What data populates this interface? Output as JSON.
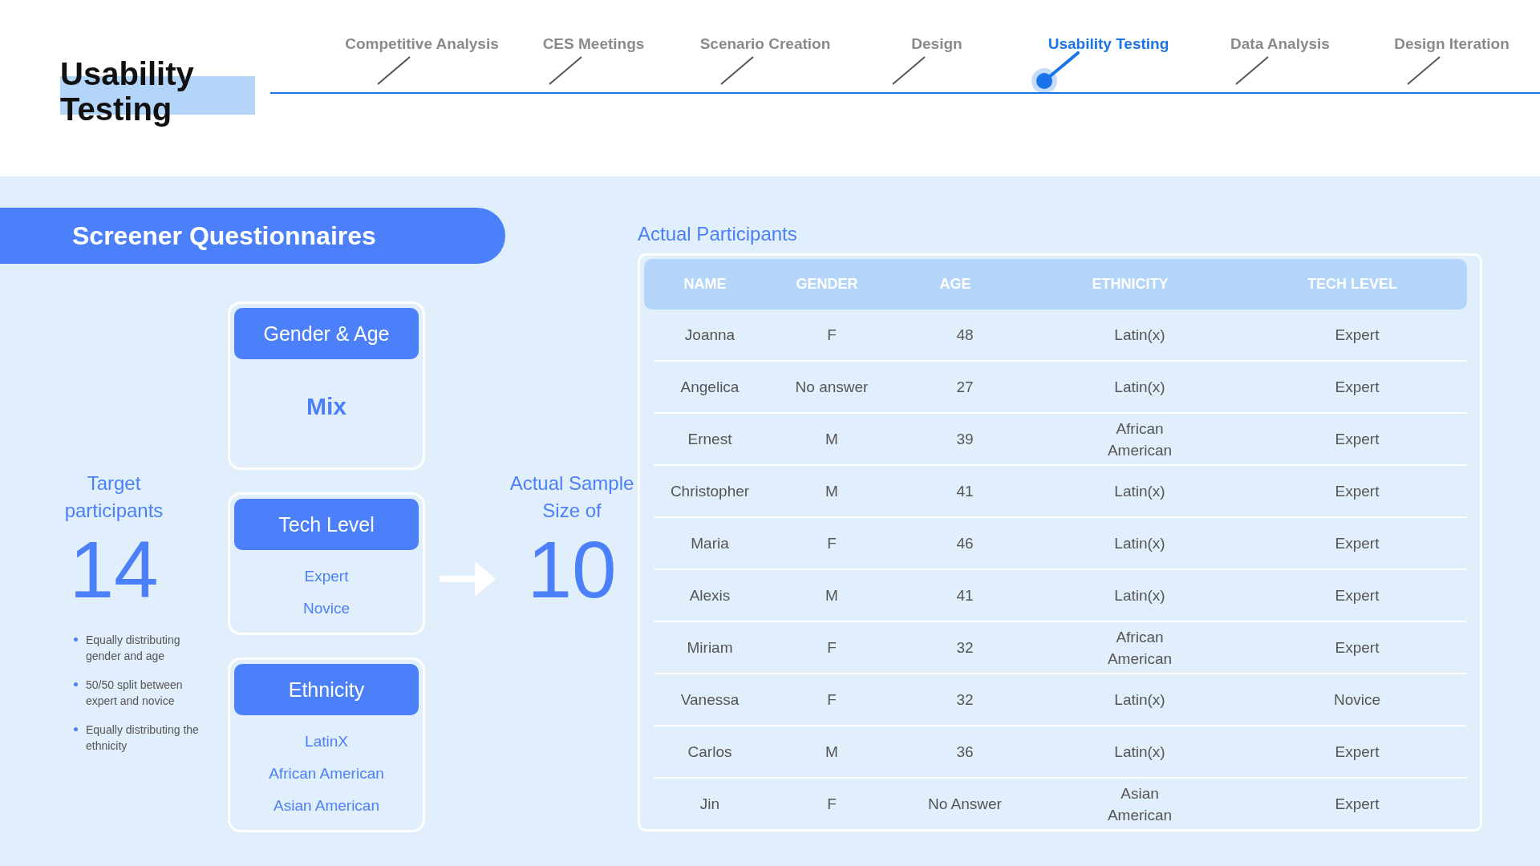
{
  "title": "Usability Testing",
  "timeline": {
    "steps": [
      {
        "label": "Competitive Analysis",
        "selected": false
      },
      {
        "label": "CES Meetings",
        "selected": false
      },
      {
        "label": "Scenario Creation",
        "selected": false
      },
      {
        "label": "Design",
        "selected": false
      },
      {
        "label": "Usability Testing",
        "selected": true
      },
      {
        "label": "Data Analysis",
        "selected": false
      },
      {
        "label": "Design Iteration",
        "selected": false
      }
    ]
  },
  "banner": "Screener Questionnaires",
  "target": {
    "label": "Target participants",
    "number": "14",
    "bullets": [
      "Equally distributing gender and age",
      "50/50 split between expert and novice",
      "Equally distributing the ethnicity"
    ]
  },
  "cards": [
    {
      "title": "Gender & Age",
      "kind": "emphasis",
      "items": [
        "Mix"
      ]
    },
    {
      "title": "Tech Level",
      "kind": "list",
      "items": [
        "Expert",
        "Novice"
      ]
    },
    {
      "title": "Ethnicity",
      "kind": "list",
      "items": [
        "LatinX",
        "African American",
        "Asian American"
      ]
    }
  ],
  "actual": {
    "label": "Actual Sample Size of",
    "number": "10"
  },
  "table": {
    "title": "Actual Participants",
    "columns": [
      "NAME",
      "GENDER",
      "AGE",
      "ETHNICITY",
      "TECH LEVEL"
    ],
    "rows": [
      [
        "Joanna",
        "F",
        "48",
        "Latin(x)",
        "Expert"
      ],
      [
        "Angelica",
        "No answer",
        "27",
        "Latin(x)",
        "Expert"
      ],
      [
        "Ernest",
        "M",
        "39",
        "African American",
        "Expert"
      ],
      [
        "Christopher",
        "M",
        "41",
        "Latin(x)",
        "Expert"
      ],
      [
        "Maria",
        "F",
        "46",
        "Latin(x)",
        "Expert"
      ],
      [
        "Alexis",
        "M",
        "41",
        "Latin(x)",
        "Expert"
      ],
      [
        "Miriam",
        "F",
        "32",
        "African American",
        "Expert"
      ],
      [
        "Vanessa",
        "F",
        "32",
        "Latin(x)",
        "Novice"
      ],
      [
        "Carlos",
        "M",
        "36",
        "Latin(x)",
        "Expert"
      ],
      [
        "Jin",
        "F",
        "No Answer",
        "Asian American",
        "Expert"
      ]
    ]
  }
}
